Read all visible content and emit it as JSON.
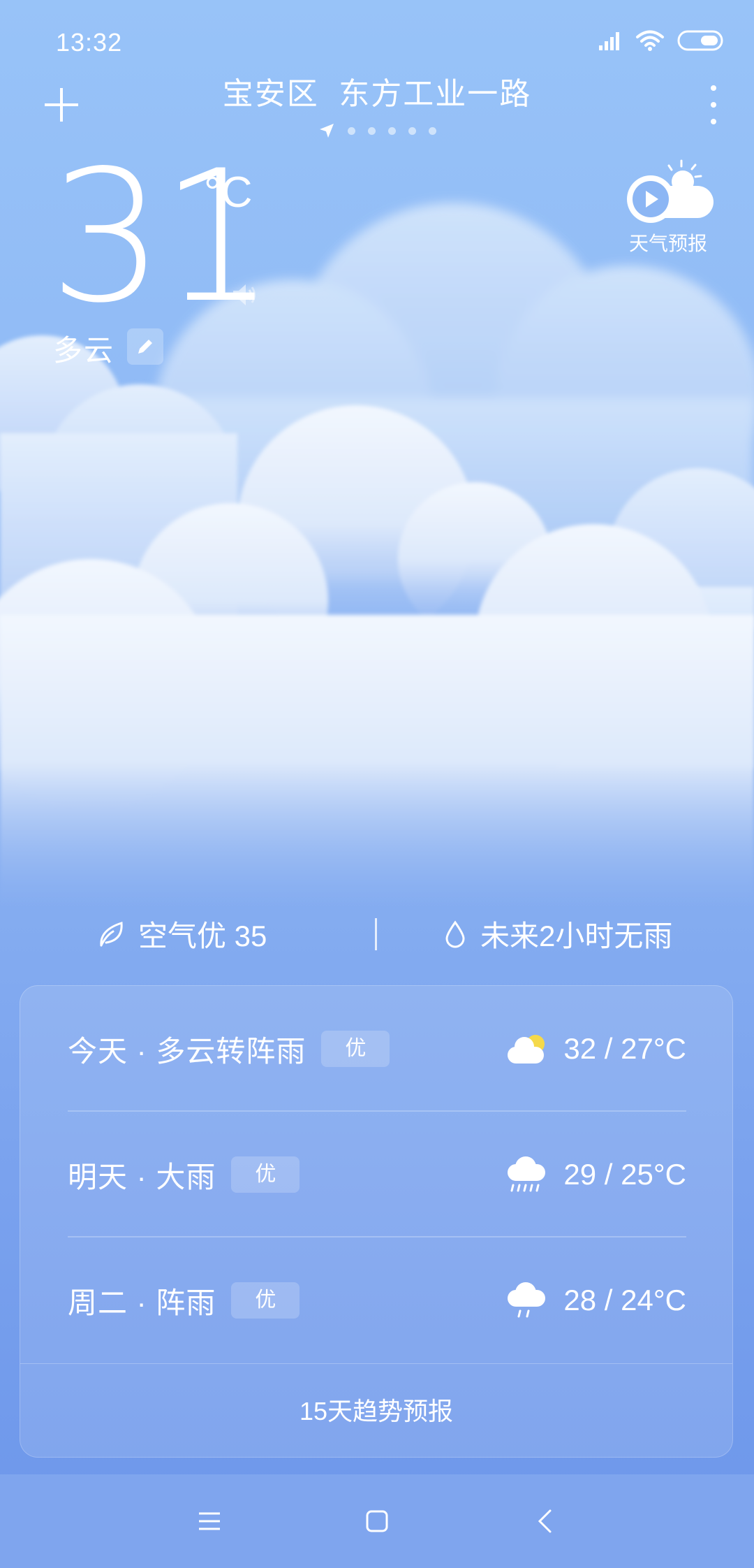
{
  "status_bar": {
    "time": "13:32",
    "icons": [
      "signal-icon",
      "wifi-icon",
      "battery-icon"
    ]
  },
  "header": {
    "location": "宝安区  东方工业一路",
    "page_count": 6,
    "current_page": 0
  },
  "current": {
    "temperature": "31",
    "unit": "°C",
    "condition": "多云"
  },
  "forecast_video": {
    "label": "天气预报"
  },
  "info": {
    "air_quality": "空气优 35",
    "rain": "未来2小时无雨"
  },
  "forecast": [
    {
      "day": "今天 · 多云转阵雨",
      "aqi": "优",
      "icon": "partly-cloudy-icon",
      "temps": "32 / 27°C"
    },
    {
      "day": "明天 · 大雨",
      "aqi": "优",
      "icon": "heavy-rain-icon",
      "temps": "29 / 25°C"
    },
    {
      "day": "周二 · 阵雨",
      "aqi": "优",
      "icon": "shower-icon",
      "temps": "28 / 24°C"
    }
  ],
  "trend_link": "15天趋势预报",
  "colors": {
    "sky_top": "#98c3f8",
    "sky_bottom": "#6c96ea",
    "sun": "#f5d94a"
  }
}
